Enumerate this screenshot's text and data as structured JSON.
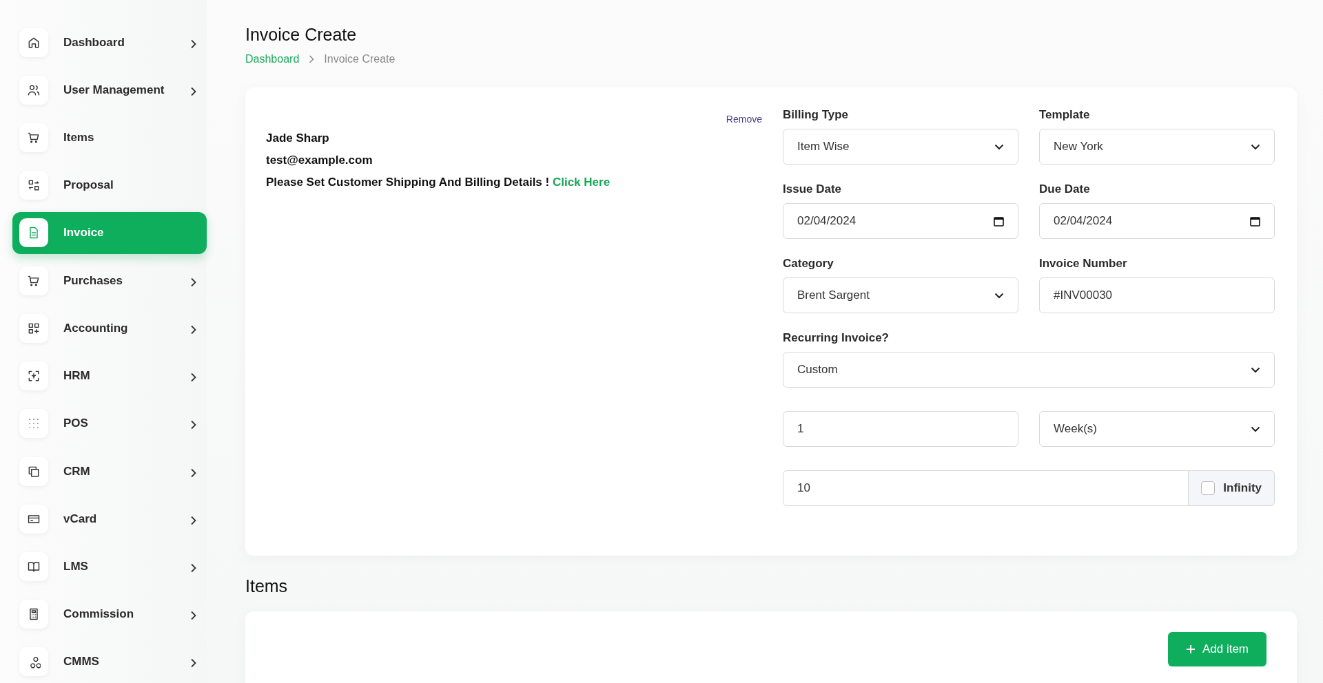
{
  "sidebar": {
    "items": [
      {
        "label": "Dashboard",
        "selected": false,
        "has_submenu": true
      },
      {
        "label": "User Management",
        "selected": false,
        "has_submenu": true
      },
      {
        "label": "Items",
        "selected": false,
        "has_submenu": false
      },
      {
        "label": "Proposal",
        "selected": false,
        "has_submenu": false
      },
      {
        "label": "Invoice",
        "selected": true,
        "has_submenu": false
      },
      {
        "label": "Purchases",
        "selected": false,
        "has_submenu": true
      },
      {
        "label": "Accounting",
        "selected": false,
        "has_submenu": true
      },
      {
        "label": "HRM",
        "selected": false,
        "has_submenu": true
      },
      {
        "label": "POS",
        "selected": false,
        "has_submenu": true
      },
      {
        "label": "CRM",
        "selected": false,
        "has_submenu": true
      },
      {
        "label": "vCard",
        "selected": false,
        "has_submenu": true
      },
      {
        "label": "LMS",
        "selected": false,
        "has_submenu": true
      },
      {
        "label": "Commission",
        "selected": false,
        "has_submenu": true
      },
      {
        "label": "CMMS",
        "selected": false,
        "has_submenu": true
      }
    ]
  },
  "page": {
    "title": "Invoice Create",
    "breadcrumb": [
      "Dashboard",
      "Invoice Create"
    ]
  },
  "customer": {
    "remove": "Remove",
    "name": "Jade Sharp",
    "email": "test@example.com",
    "notice": "Please Set Customer Shipping And Billing Details !",
    "link": "Click Here"
  },
  "form": {
    "fields": [
      {
        "label": "Billing Type",
        "kind": "select",
        "value": "Item Wise",
        "wide": false
      },
      {
        "label": "Template",
        "kind": "select",
        "value": "New York",
        "wide": false
      },
      {
        "label": "Issue Date",
        "kind": "date",
        "value": "02/04/2024",
        "wide": false
      },
      {
        "label": "Due Date",
        "kind": "date",
        "value": "02/04/2024",
        "wide": false
      },
      {
        "label": "Category",
        "kind": "select",
        "value": "Brent Sargent",
        "wide": false
      },
      {
        "label": "Invoice Number",
        "kind": "text",
        "value": "#INV00030",
        "wide": false
      },
      {
        "label": "Recurring Invoice?",
        "kind": "select",
        "value": "Custom",
        "wide": true
      },
      {
        "kind": "text",
        "value": "1",
        "wide": false
      },
      {
        "kind": "select",
        "value": "Week(s)",
        "wide": false
      },
      {
        "kind": "checkgroup",
        "value": "10",
        "wide": true,
        "check_label": "Infinity",
        "checked": false
      }
    ]
  },
  "items_section": {
    "title": "Items",
    "add_button": "Add item"
  }
}
